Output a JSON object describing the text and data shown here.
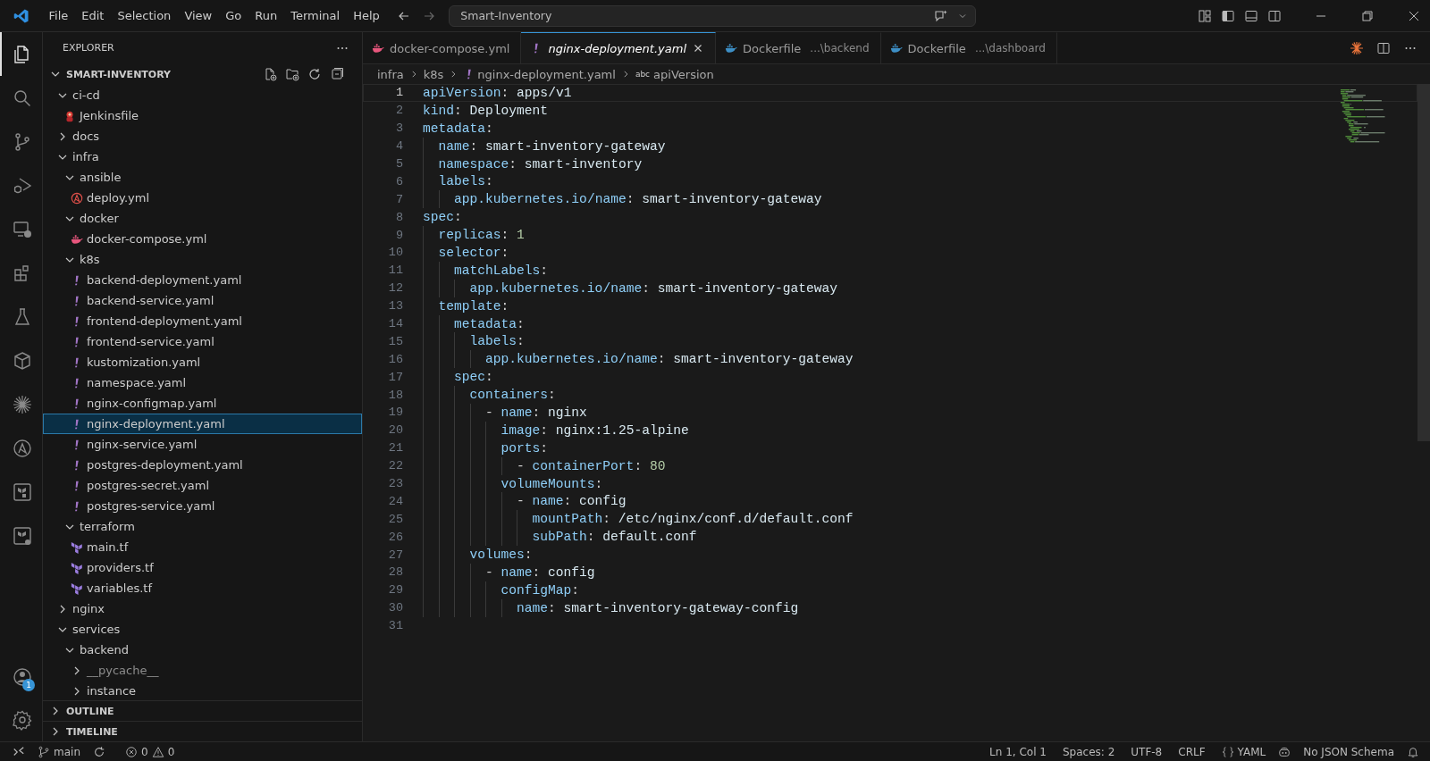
{
  "menu": [
    "File",
    "Edit",
    "Selection",
    "View",
    "Go",
    "Run",
    "Terminal",
    "Help"
  ],
  "search": {
    "value": "Smart-Inventory"
  },
  "activity_bar": [
    {
      "kind": "explorer",
      "selected": true
    },
    {
      "kind": "search",
      "selected": false
    },
    {
      "kind": "source-control",
      "selected": false
    },
    {
      "kind": "debug",
      "selected": false
    },
    {
      "kind": "remote",
      "selected": false
    },
    {
      "kind": "extensions",
      "selected": false
    },
    {
      "kind": "testing",
      "selected": false
    },
    {
      "kind": "containers",
      "selected": false
    },
    {
      "kind": "sparkle",
      "selected": false
    },
    {
      "kind": "ansible",
      "selected": false
    },
    {
      "kind": "terraform",
      "selected": false
    },
    {
      "kind": "terraform-cloud",
      "selected": false
    }
  ],
  "accounts_badge": "1",
  "explorer": {
    "title": "EXPLORER",
    "root": "SMART-INVENTORY",
    "tree": [
      {
        "label": "ci-cd",
        "expanded": true,
        "selected": false,
        "children": [
          {
            "label": "Jenkinsfile",
            "kind": "jenkins",
            "selected": false
          }
        ]
      },
      {
        "label": "docs",
        "expanded": false,
        "selected": false
      },
      {
        "label": "infra",
        "expanded": true,
        "selected": false,
        "children": [
          {
            "label": "ansible",
            "expanded": true,
            "selected": false,
            "children": [
              {
                "label": "deploy.yml",
                "kind": "ansible",
                "selected": false
              }
            ]
          },
          {
            "label": "docker",
            "expanded": true,
            "selected": false,
            "children": [
              {
                "label": "docker-compose.yml",
                "kind": "docker",
                "selected": false
              }
            ]
          },
          {
            "label": "k8s",
            "expanded": true,
            "selected": false,
            "children": [
              {
                "label": "backend-deployment.yaml",
                "kind": "yaml",
                "selected": false
              },
              {
                "label": "backend-service.yaml",
                "kind": "yaml",
                "selected": false
              },
              {
                "label": "frontend-deployment.yaml",
                "kind": "yaml",
                "selected": false
              },
              {
                "label": "frontend-service.yaml",
                "kind": "yaml",
                "selected": false
              },
              {
                "label": "kustomization.yaml",
                "kind": "yaml",
                "selected": false
              },
              {
                "label": "namespace.yaml",
                "kind": "yaml",
                "selected": false
              },
              {
                "label": "nginx-configmap.yaml",
                "kind": "yaml",
                "selected": false
              },
              {
                "label": "nginx-deployment.yaml",
                "kind": "yaml",
                "selected": true
              },
              {
                "label": "nginx-service.yaml",
                "kind": "yaml",
                "selected": false
              },
              {
                "label": "postgres-deployment.yaml",
                "kind": "yaml",
                "selected": false
              },
              {
                "label": "postgres-secret.yaml",
                "kind": "yaml",
                "selected": false
              },
              {
                "label": "postgres-service.yaml",
                "kind": "yaml",
                "selected": false
              }
            ]
          },
          {
            "label": "terraform",
            "expanded": true,
            "selected": false,
            "children": [
              {
                "label": "main.tf",
                "kind": "terraform",
                "selected": false
              },
              {
                "label": "providers.tf",
                "kind": "terraform",
                "selected": false
              },
              {
                "label": "variables.tf",
                "kind": "terraform",
                "selected": false
              }
            ]
          }
        ]
      },
      {
        "label": "nginx",
        "expanded": false,
        "selected": false
      },
      {
        "label": "services",
        "expanded": true,
        "selected": false,
        "children": [
          {
            "label": "backend",
            "expanded": true,
            "selected": false,
            "children": [
              {
                "label": "__pycache__",
                "expanded": false,
                "selected": false,
                "dimmed": true
              },
              {
                "label": "instance",
                "expanded": false,
                "selected": false,
                "dimmed": false
              }
            ]
          }
        ]
      }
    ],
    "sections": [
      "OUTLINE",
      "TIMELINE"
    ]
  },
  "tabs": [
    {
      "label": "docker-compose.yml",
      "kind": "docker",
      "selected": false,
      "preview": false
    },
    {
      "label": "nginx-deployment.yaml",
      "kind": "yaml",
      "selected": true,
      "preview": true
    },
    {
      "label": "Dockerfile",
      "description": "...\\backend",
      "kind": "docker-blue",
      "selected": false,
      "preview": false
    },
    {
      "label": "Dockerfile",
      "description": "...\\dashboard",
      "kind": "docker-blue",
      "selected": false,
      "preview": false
    }
  ],
  "breadcrumb": [
    {
      "label": "infra",
      "kind": "folder"
    },
    {
      "label": "k8s",
      "kind": "folder"
    },
    {
      "label": "nginx-deployment.yaml",
      "kind": "yaml"
    },
    {
      "label": "apiVersion",
      "kind": "symbol",
      "symbol": "abc"
    }
  ],
  "code": [
    {
      "number": "1",
      "text": "apiVersion: apps/v1",
      "selected": true
    },
    {
      "number": "2",
      "text": "kind: Deployment",
      "selected": false
    },
    {
      "number": "3",
      "text": "metadata:",
      "selected": false
    },
    {
      "number": "4",
      "text": "  name: smart-inventory-gateway",
      "selected": false
    },
    {
      "number": "5",
      "text": "  namespace: smart-inventory",
      "selected": false
    },
    {
      "number": "6",
      "text": "  labels:",
      "selected": false
    },
    {
      "number": "7",
      "text": "    app.kubernetes.io/name: smart-inventory-gateway",
      "selected": false
    },
    {
      "number": "8",
      "text": "spec:",
      "selected": false
    },
    {
      "number": "9",
      "text": "  replicas: 1",
      "selected": false
    },
    {
      "number": "10",
      "text": "  selector:",
      "selected": false
    },
    {
      "number": "11",
      "text": "    matchLabels:",
      "selected": false
    },
    {
      "number": "12",
      "text": "      app.kubernetes.io/name: smart-inventory-gateway",
      "selected": false
    },
    {
      "number": "13",
      "text": "  template:",
      "selected": false
    },
    {
      "number": "14",
      "text": "    metadata:",
      "selected": false
    },
    {
      "number": "15",
      "text": "      labels:",
      "selected": false
    },
    {
      "number": "16",
      "text": "        app.kubernetes.io/name: smart-inventory-gateway",
      "selected": false
    },
    {
      "number": "17",
      "text": "    spec:",
      "selected": false
    },
    {
      "number": "18",
      "text": "      containers:",
      "selected": false
    },
    {
      "number": "19",
      "text": "        - name: nginx",
      "selected": false
    },
    {
      "number": "20",
      "text": "          image: nginx:1.25-alpine",
      "selected": false
    },
    {
      "number": "21",
      "text": "          ports:",
      "selected": false
    },
    {
      "number": "22",
      "text": "            - containerPort: 80",
      "selected": false
    },
    {
      "number": "23",
      "text": "          volumeMounts:",
      "selected": false
    },
    {
      "number": "24",
      "text": "            - name: config",
      "selected": false
    },
    {
      "number": "25",
      "text": "              mountPath: /etc/nginx/conf.d/default.conf",
      "selected": false
    },
    {
      "number": "26",
      "text": "              subPath: default.conf",
      "selected": false
    },
    {
      "number": "27",
      "text": "      volumes:",
      "selected": false
    },
    {
      "number": "28",
      "text": "        - name: config",
      "selected": false
    },
    {
      "number": "29",
      "text": "          configMap:",
      "selected": false
    },
    {
      "number": "30",
      "text": "            name: smart-inventory-gateway-config",
      "selected": false
    },
    {
      "number": "31",
      "selected": false
    }
  ],
  "status_bar": {
    "branch": "main",
    "errors": "0",
    "warnings": "0",
    "position": "Ln 1, Col 1",
    "indentation": "Spaces: 2",
    "encoding": "UTF-8",
    "eol": "CRLF",
    "language": "YAML",
    "schema": "No JSON Schema"
  }
}
